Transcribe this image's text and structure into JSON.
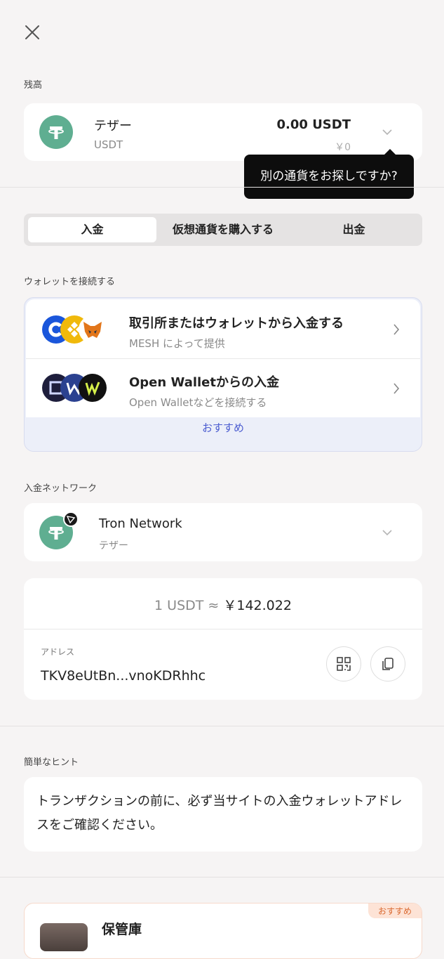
{
  "header": {
    "close_icon": "close-icon"
  },
  "balance": {
    "section_label": "残高",
    "currency_name": "テザー",
    "currency_code": "USDT",
    "amount": "0.00 USDT",
    "fiat_amount": "￥0",
    "tooltip": "別の通貨をお探しですか?"
  },
  "tabs": [
    {
      "label": "入金",
      "active": true
    },
    {
      "label": "仮想通貨を購入する",
      "active": false
    },
    {
      "label": "出金",
      "active": false
    }
  ],
  "connect": {
    "section_label": "ウォレットを接続する",
    "options": [
      {
        "title": "取引所またはウォレットから入金する",
        "subtitle": "MESH によって提供"
      },
      {
        "title": "Open Walletからの入金",
        "subtitle": "Open Walletなどを接続する"
      }
    ],
    "recommended_label": "おすすめ"
  },
  "network": {
    "section_label": "入金ネットワーク",
    "name": "Tron Network",
    "currency": "テザー"
  },
  "rate": {
    "left": "1 USDT ≈",
    "right": "￥142.022"
  },
  "address": {
    "label": "アドレス",
    "value": "TKV8eUtBn...vnoKDRhhc"
  },
  "hint": {
    "section_label": "簡単なヒント",
    "text": "トランザクションの前に、必ず当サイトの入金ウォレットアドレスをご確認ください。"
  },
  "vault": {
    "title": "保管庫",
    "badge": "おすすめ"
  },
  "colors": {
    "tether": "#5fae91",
    "recommended_bg": "#eceff9",
    "recommended_text": "#4a5bd0",
    "badge": "#d9682f"
  }
}
